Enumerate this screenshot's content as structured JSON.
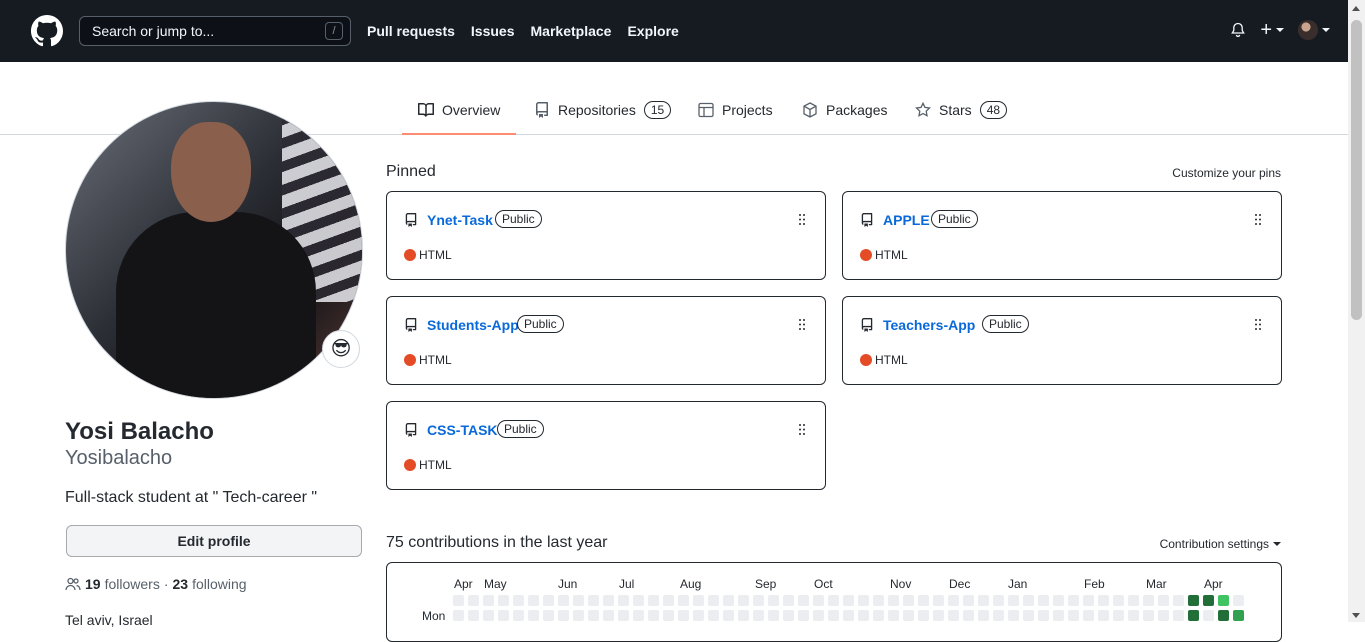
{
  "header": {
    "search_placeholder": "Search or jump to...",
    "search_shortcut": "/",
    "nav": [
      "Pull requests",
      "Issues",
      "Marketplace",
      "Explore"
    ],
    "plus_label": "+"
  },
  "tabs": [
    {
      "label": "Overview",
      "icon": "book-icon",
      "active": true
    },
    {
      "label": "Repositories",
      "icon": "repo-icon",
      "count": "15"
    },
    {
      "label": "Projects",
      "icon": "table-icon"
    },
    {
      "label": "Packages",
      "icon": "package-icon"
    },
    {
      "label": "Stars",
      "icon": "star-icon",
      "count": "48"
    }
  ],
  "profile": {
    "status_emoji": "😎",
    "full_name": "Yosi Balacho",
    "username": "Yosibalacho",
    "bio": "Full-stack student at \" Tech-career \"",
    "edit_button": "Edit profile",
    "followers_count": "19",
    "followers_label": "followers",
    "separator": "·",
    "following_count": "23",
    "following_label": "following",
    "next_row_text": "Tel aviv, Israel"
  },
  "pinned": {
    "heading": "Pinned",
    "customize_label": "Customize your pins",
    "repos": [
      {
        "name": "Ynet-Task",
        "visibility": "Public",
        "language": "HTML",
        "language_color": "#e34c26"
      },
      {
        "name": "APPLE",
        "visibility": "Public",
        "language": "HTML",
        "language_color": "#e34c26"
      },
      {
        "name": "Students-App",
        "visibility": "Public",
        "language": "HTML",
        "language_color": "#e34c26"
      },
      {
        "name": "Teachers-App",
        "visibility": "Public",
        "language": "HTML",
        "language_color": "#e34c26"
      },
      {
        "name": "CSS-TASK",
        "visibility": "Public",
        "language": "HTML",
        "language_color": "#e34c26"
      }
    ]
  },
  "contributions": {
    "heading": "75 contributions in the last year",
    "settings_label": "Contribution settings",
    "months": [
      "Apr",
      "May",
      "Jun",
      "Jul",
      "Aug",
      "Sep",
      "Oct",
      "Nov",
      "Dec",
      "Jan",
      "Feb",
      "Mar",
      "Apr"
    ],
    "day_label": "Mon",
    "colors": {
      "empty": "#ebedf0",
      "l2": "#40c463",
      "l3": "#30a14e",
      "l4": "#216e39"
    }
  },
  "colors": {
    "header_bg": "#161b22",
    "link": "#0969da",
    "active_tab_underline": "#fd8c73"
  }
}
